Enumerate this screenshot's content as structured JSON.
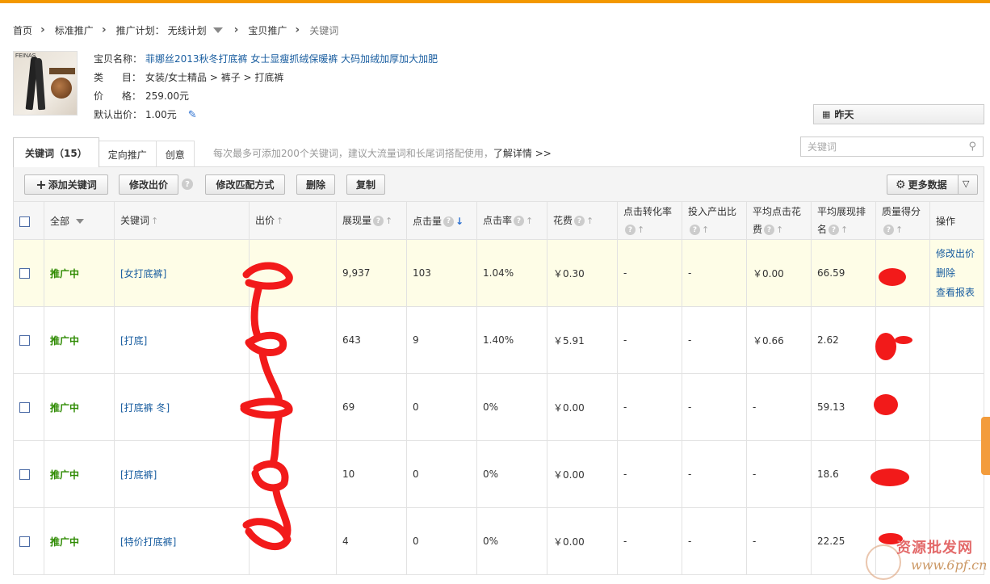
{
  "breadcrumb": {
    "home": "首页",
    "standard": "标准推广",
    "plan_label": "推广计划：",
    "plan_value": "无线计划",
    "item_promo": "宝贝推广",
    "current": "关键词"
  },
  "product": {
    "logo_text": "FEINAS",
    "name_label": "宝贝名称：",
    "name": "菲娜丝2013秋冬打底裤 女士显瘦抓绒保暖裤 大码加绒加厚加大加肥",
    "category_label": "类      目：",
    "category": "女装/女士精品 > 裤子 > 打底裤",
    "price_label": "价      格：",
    "price": "259.00元",
    "default_bid_label": "默认出价：",
    "default_bid": "1.00元"
  },
  "date_selector": {
    "label": "昨天"
  },
  "tabs": [
    {
      "label": "关键词（15）"
    },
    {
      "label": "定向推广"
    },
    {
      "label": "创意"
    }
  ],
  "tip": {
    "text": "每次最多可添加200个关键词，建议大流量词和长尾词搭配使用，",
    "link": "了解详情 >>"
  },
  "search": {
    "placeholder": "关键词"
  },
  "toolbar": {
    "add": "添加关键词",
    "modify_bid": "修改出价",
    "modify_match": "修改匹配方式",
    "delete": "删除",
    "copy": "复制",
    "more_data": "更多数据"
  },
  "columns": {
    "all": "全部",
    "keyword": "关键词",
    "bid": "出价",
    "impressions": "展现量",
    "clicks": "点击量",
    "ctr": "点击率",
    "cost": "花费",
    "conversion_1": "点击转化率",
    "roi_1": "投入产出比",
    "avg_cpc_1": "平均点击花",
    "avg_cpc_2": "费",
    "avg_rank_1": "平均展现排",
    "avg_rank_2": "名",
    "quality": "质量得分",
    "ops": "操作"
  },
  "rows": [
    {
      "status": "推广中",
      "keyword": "[女打底裤]",
      "impressions": "9,937",
      "clicks": "103",
      "ctr": "1.04%",
      "cost": "￥0.30",
      "conversion": "-",
      "roi": "-",
      "avg_cpc": "￥0.00",
      "avg_rank": "66.59"
    },
    {
      "status": "推广中",
      "keyword": "[打底]",
      "impressions": "643",
      "clicks": "9",
      "ctr": "1.40%",
      "cost": "￥5.91",
      "conversion": "-",
      "roi": "-",
      "avg_cpc": "￥0.66",
      "avg_rank": "2.62"
    },
    {
      "status": "推广中",
      "keyword": "[打底裤 冬]",
      "impressions": "69",
      "clicks": "0",
      "ctr": "0%",
      "cost": "￥0.00",
      "conversion": "-",
      "roi": "-",
      "avg_cpc": "-",
      "avg_rank": "59.13"
    },
    {
      "status": "推广中",
      "keyword": "[打底裤]",
      "impressions": "10",
      "clicks": "0",
      "ctr": "0%",
      "cost": "￥0.00",
      "conversion": "-",
      "roi": "-",
      "avg_cpc": "-",
      "avg_rank": "18.6"
    },
    {
      "status": "推广中",
      "keyword": "[特价打底裤]",
      "impressions": "4",
      "clicks": "0",
      "ctr": "0%",
      "cost": "￥0.00",
      "conversion": "-",
      "roi": "-",
      "avg_cpc": "-",
      "avg_rank": "22.25"
    }
  ],
  "row_ops": {
    "modify_bid": "修改出价",
    "delete": "删除",
    "view_report": "查看报表"
  },
  "watermark": {
    "line1": "资源批发网",
    "line2": "www.6pf.cn"
  },
  "icons": {
    "breadcrumb_sep": "chevron-right-icon",
    "plan_dropdown": "caret-down-icon",
    "edit": "pencil-icon",
    "calendar": "calendar-icon",
    "search": "search-icon",
    "add": "plus-icon",
    "help": "question-icon",
    "settings": "gear-icon",
    "sort": "sort-arrow-icon"
  },
  "colors": {
    "accent_orange": "#f39800",
    "link_blue": "#1a5ea0",
    "status_green": "#2d8a00",
    "highlight_row": "#fefde7",
    "redaction_red": "#f21a1a"
  }
}
